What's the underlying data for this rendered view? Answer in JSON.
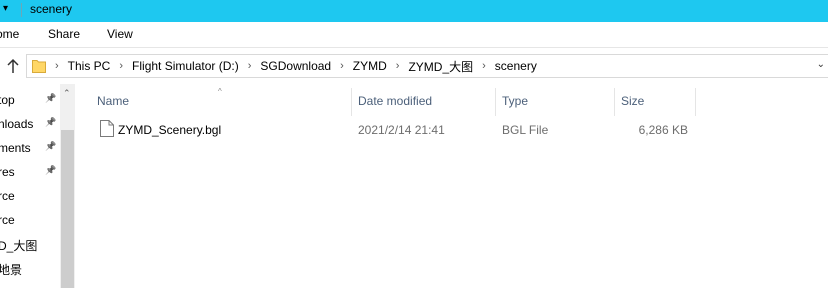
{
  "window": {
    "title": "scenery",
    "quick_access_glyph": "▾"
  },
  "ribbon": {
    "tabs": [
      "ome",
      "Share",
      "View"
    ]
  },
  "address": {
    "up_icon": "up-arrow-icon",
    "folder_icon": "folder-icon",
    "breadcrumbs": [
      "This PC",
      "Flight Simulator (D:)",
      "SGDownload",
      "ZYMD",
      "ZYMD_大图",
      "scenery"
    ]
  },
  "nav": {
    "items": [
      {
        "label": "top",
        "pinned": true
      },
      {
        "label": "nloads",
        "pinned": true
      },
      {
        "label": "ments",
        "pinned": true
      },
      {
        "label": "res",
        "pinned": true
      },
      {
        "label": "rce",
        "pinned": false
      },
      {
        "label": "rce",
        "pinned": false
      },
      {
        "label": "D_大图",
        "pinned": false
      },
      {
        "label": "地景",
        "pinned": false
      }
    ],
    "pin_icon": "pin-icon"
  },
  "columns": {
    "name": "Name",
    "date": "Date modified",
    "type": "Type",
    "size": "Size"
  },
  "files": [
    {
      "name": "ZYMD_Scenery.bgl",
      "date": "2021/2/14 21:41",
      "type": "BGL File",
      "size": "6,286 KB",
      "icon": "file-icon"
    }
  ]
}
